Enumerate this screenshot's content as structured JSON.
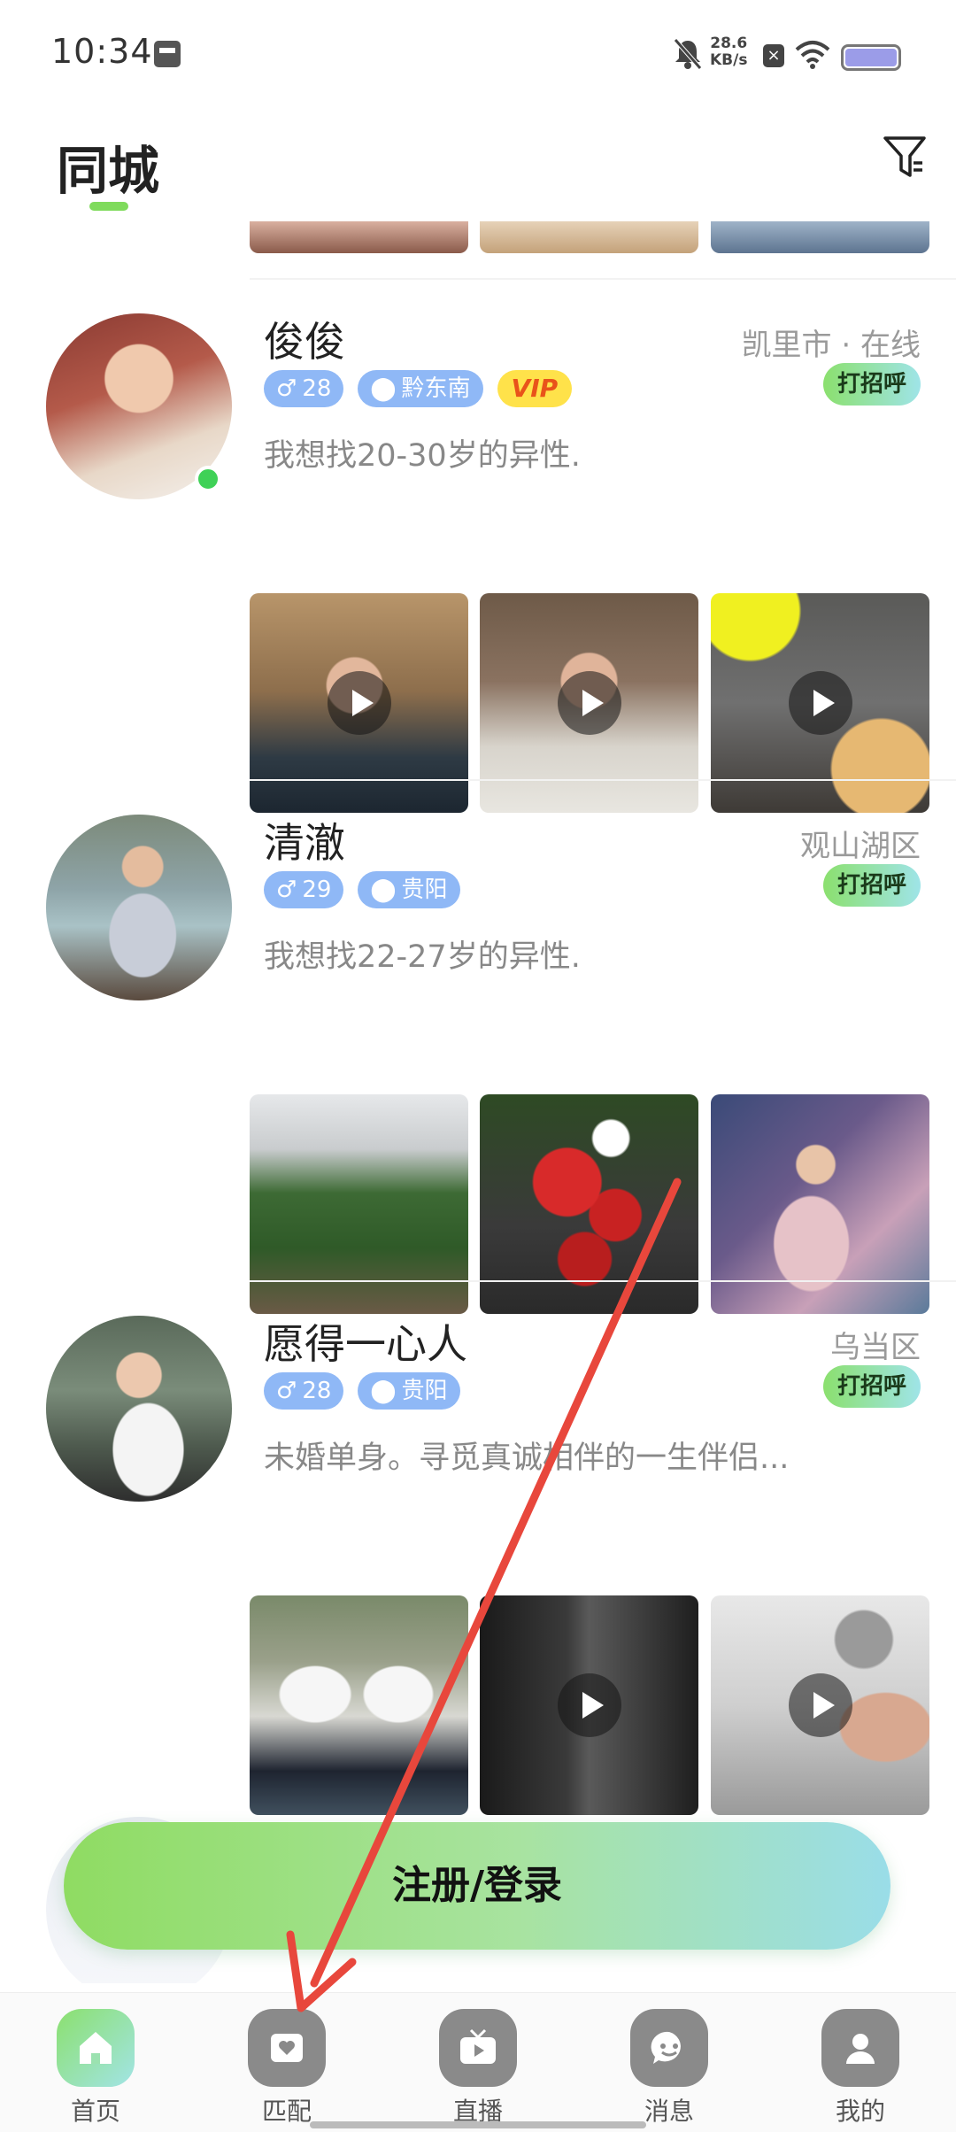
{
  "status_bar": {
    "time": "10:34",
    "net_speed_value": "28.6",
    "net_speed_unit": "KB/s"
  },
  "header": {
    "title": "同城"
  },
  "users": [
    {
      "name": "俊俊",
      "location": "凯里市 · 在线",
      "age": "28",
      "region": "黔东南",
      "vip": "VIP",
      "bio": "我想找20-30岁的异性.",
      "greet": "打招呼",
      "online": true
    },
    {
      "name": "清澈",
      "location": "观山湖区",
      "age": "29",
      "region": "贵阳",
      "bio": "我想找22-27岁的异性.",
      "greet": "打招呼"
    },
    {
      "name": "愿得一心人",
      "location": "乌当区",
      "age": "28",
      "region": "贵阳",
      "bio": "未婚单身。寻觅真诚相伴的一生伴侣...",
      "greet": "打招呼"
    }
  ],
  "login_button": {
    "label": "注册/登录"
  },
  "bottom_nav": [
    {
      "label": "首页",
      "icon": "home-icon",
      "active": true
    },
    {
      "label": "匹配",
      "icon": "match-icon"
    },
    {
      "label": "直播",
      "icon": "live-tv-icon"
    },
    {
      "label": "消息",
      "icon": "message-icon"
    },
    {
      "label": "我的",
      "icon": "profile-icon"
    }
  ],
  "colors": {
    "accent_green": "#7fdb5c",
    "tag_blue": "#8fb8f6",
    "vip_yellow": "#ffe24a",
    "online_green": "#3fd157",
    "arrow_red": "#e8473c"
  }
}
